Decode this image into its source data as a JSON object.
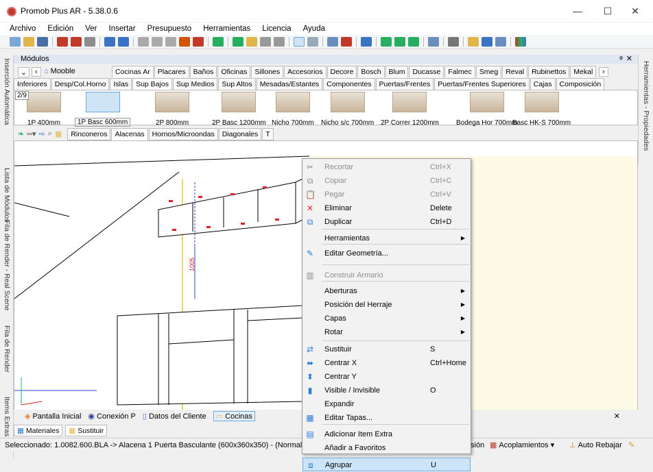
{
  "app": {
    "title": "Promob Plus AR - 5.38.0.6",
    "minimize": "—",
    "maximize": "☐",
    "close": "✕"
  },
  "menu": [
    "Archivo",
    "Edición",
    "Ver",
    "Insertar",
    "Presupuesto",
    "Herramientas",
    "Licencia",
    "Ayuda"
  ],
  "modules": {
    "title": "Módulos",
    "pin": "ᵠ",
    "close": "✕"
  },
  "lib_nav": {
    "down": "⌄",
    "back": "‹",
    "home_label": "Mooble",
    "next": "›"
  },
  "lib_tabs": [
    "Cocinas Ar",
    "Placares",
    "Baños",
    "Oficinas",
    "Sillones",
    "Accesorios",
    "Decore",
    "Bosch",
    "Blum",
    "Ducasse",
    "Falmec",
    "Smeg",
    "Reval",
    "Rubinettos",
    "Mekal"
  ],
  "cat_tabs": [
    "Inferiores",
    "Desp/Col.Horno",
    "Islas",
    "Sup Bajos",
    "Sup Medios",
    "Sup Altos",
    "Mesadas/Estantes",
    "Componentes",
    "Puertas/Frentes",
    "Puertas/Frentes Superiores",
    "Cajas",
    "Composición"
  ],
  "active_cat_tab": "Sup Bajos",
  "page_badge": "2/9",
  "catalog": [
    "1P 400mm",
    "1P Basc 600mm",
    "2P 800mm",
    "2P Basc 1200mm",
    "Nicho 700mm",
    "Nicho s/c 700mm",
    "2P Correr 1200mm",
    "Bodega Hor 700mm",
    "Basc HK-S 700mm"
  ],
  "selected_catalog": "1P Basc 600mm",
  "sub_tabs": [
    "Rinconeros",
    "Alacenas",
    "Hornos/Microondas",
    "Diagonales",
    "T"
  ],
  "active_sub_tab": "Alacenas",
  "side_tabs_left": [
    "Inserción Automática",
    "Lista de Módulos",
    "Fila de Render - Real Scene",
    "Fila de Render",
    "Items Extras"
  ],
  "side_tabs_right": [
    "Herramientas - Propiedades"
  ],
  "viewport": {
    "dimension_label": "1005"
  },
  "bottom_tabs": [
    "Pantalla Inicial",
    "Conexión P",
    "Datos del Cliente",
    "Cocinas"
  ],
  "active_bottom_tab": "Cocinas",
  "bottom_close": "✕",
  "mat_tabs": [
    "Materiales",
    "Sustituir"
  ],
  "status": {
    "text": "Seleccionado: 1.0082.600.BLA -> Alacena 1 Puerta Basculante (600x360x350) - (Normal: 0; 0;",
    "btn1": "sión",
    "btn2": "Acoplamientos",
    "btn3": "Auto Rebajar"
  },
  "context_menu": [
    {
      "label": "Recortar",
      "shortcut": "Ctrl+X",
      "disabled": true,
      "icon": "cut-icon",
      "glyph": "✂"
    },
    {
      "label": "Copiar",
      "shortcut": "Ctrl+C",
      "disabled": true,
      "icon": "copy-icon",
      "glyph": "⧉"
    },
    {
      "label": "Pegar",
      "shortcut": "Ctrl+V",
      "disabled": true,
      "icon": "paste-icon",
      "glyph": "📋"
    },
    {
      "label": "Eliminar",
      "shortcut": "Delete",
      "disabled": false,
      "icon": "delete-icon",
      "glyph": "✕"
    },
    {
      "label": "Duplicar",
      "shortcut": "Ctrl+D",
      "disabled": false,
      "icon": "duplicate-icon",
      "glyph": "⧉"
    },
    {
      "label": "Herramientas",
      "submenu": true
    },
    {
      "label": "Editar Geometría...",
      "icon": "geometry-icon",
      "glyph": "✎"
    },
    {
      "label": "Construir Armario",
      "disabled": true,
      "icon": "wardrobe-icon",
      "glyph": "▥"
    },
    {
      "label": "Aberturas",
      "submenu": true
    },
    {
      "label": "Posición del Herraje",
      "submenu": true
    },
    {
      "label": "Capas",
      "submenu": true
    },
    {
      "label": "Rotar",
      "submenu": true
    },
    {
      "label": "Sustituir",
      "shortcut": "S",
      "icon": "substitute-icon",
      "glyph": "⇄"
    },
    {
      "label": "Centrar X",
      "shortcut": "Ctrl+Home",
      "icon": "center-x-icon",
      "glyph": "⬌"
    },
    {
      "label": "Centrar Y",
      "icon": "center-y-icon",
      "glyph": "⬍"
    },
    {
      "label": "Visible / Invisible",
      "shortcut": "O",
      "icon": "visibility-icon",
      "glyph": "▮"
    },
    {
      "label": "Expandir"
    },
    {
      "label": "Editar Tapas...",
      "icon": "covers-icon",
      "glyph": "▦"
    },
    {
      "label": "Adicionar Item Extra",
      "icon": "extra-item-icon",
      "glyph": "▤"
    },
    {
      "label": "Añadir a Favoritos"
    },
    {
      "label": "Agrupar",
      "shortcut": "U",
      "highlighted": true,
      "icon": "group-icon",
      "glyph": "⧈"
    }
  ]
}
